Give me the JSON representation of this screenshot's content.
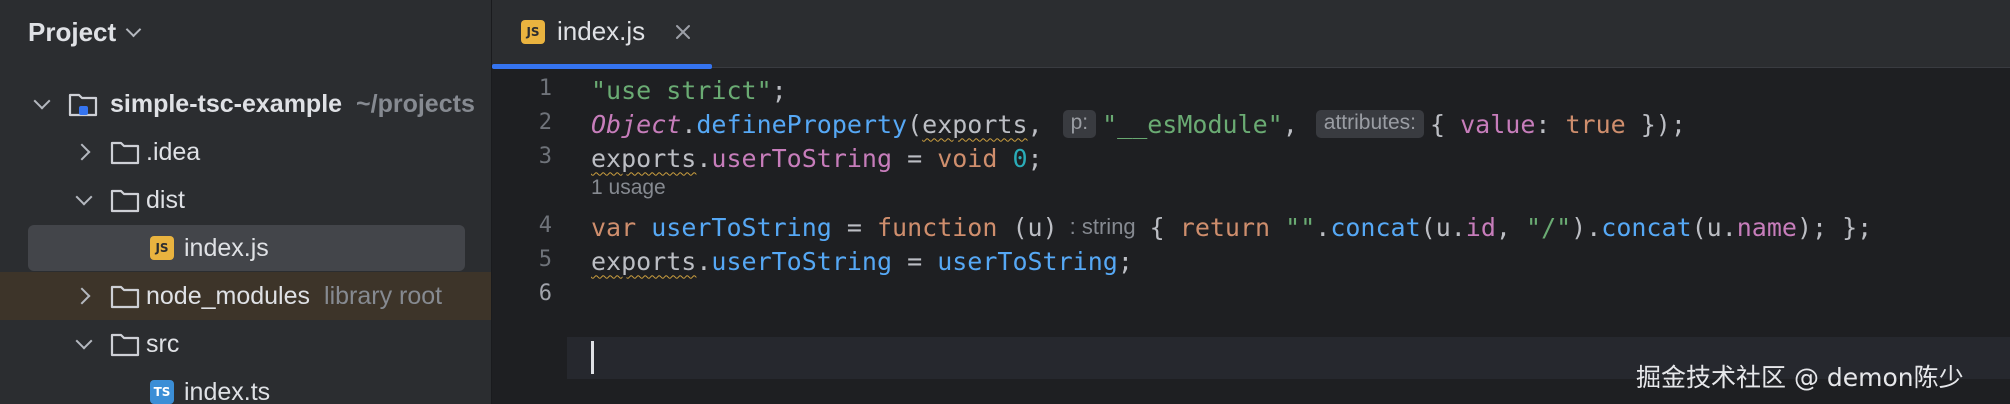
{
  "project": {
    "title": "Project",
    "tree": [
      {
        "label": "simple-tsc-example",
        "hint": "~/projects",
        "type": "root-folder",
        "expanded": true
      },
      {
        "label": ".idea",
        "type": "folder",
        "expanded": false
      },
      {
        "label": "dist",
        "type": "folder",
        "expanded": true
      },
      {
        "label": "index.js",
        "type": "js-file",
        "selected": true
      },
      {
        "label": "node_modules",
        "hint": "library root",
        "type": "folder",
        "expanded": false
      },
      {
        "label": "src",
        "type": "folder",
        "expanded": true
      },
      {
        "label": "index.ts",
        "type": "ts-file"
      }
    ]
  },
  "editor": {
    "tab": {
      "label": "index.js",
      "icon": "JS",
      "close": "✕"
    },
    "line_numbers": [
      "1",
      "2",
      "3",
      "4",
      "5",
      "6"
    ],
    "current_line": "6",
    "usage_hint": "1 usage",
    "lines": {
      "l1": {
        "str": "\"use strict\"",
        "semi": ";"
      },
      "l2": {
        "glob": "Object",
        "dot": ".",
        "fn": "defineProperty",
        "open": "(",
        "arg1": "exports",
        "comma1": ",",
        "inlay1": "p:",
        "str": "\"__esModule\"",
        "comma2": ",",
        "inlay2": "attributes:",
        "brace_open": "{ ",
        "prop": "value",
        "colon": ": ",
        "kw": "true",
        "tail": " });"
      },
      "l3": {
        "obj": "exports",
        "dot": ".",
        "prop": "userToString",
        "eq": " = ",
        "kw": "void",
        "sp": " ",
        "num": "0",
        "semi": ";"
      },
      "l4": {
        "kw_var": "var",
        "sp1": " ",
        "name": "userToString",
        "eq": " = ",
        "kw_fn": "function",
        "params": " (u)",
        "type_hint": ": string",
        "brace": "{ ",
        "kw_ret": "return",
        "sp2": " ",
        "str_empty": "\"\"",
        "dot1": ".",
        "fn1": "concat",
        "p1": "(u.",
        "prop_id": "id",
        "comma": ", ",
        "str_slash": "\"/\"",
        "close1": ").",
        "fn2": "concat",
        "p2": "(u.",
        "prop_name": "name",
        "tail": "); };"
      },
      "l5": {
        "obj": "exports",
        "dot": ".",
        "prop": "userToString",
        "eq": " = ",
        "ref": "userToString",
        "semi": ";"
      }
    }
  },
  "watermark": "掘金技术社区 @ demon陈少",
  "colors": {
    "panel_bg": "#2b2d30",
    "editor_bg": "#1e1f22",
    "selection": "#43454a",
    "library_row": "#3d3429",
    "accent": "#3574f0",
    "string": "#6aab73",
    "keyword": "#cf8e6d",
    "function": "#56a8f5",
    "number": "#2aacb8",
    "property": "#c77dbb"
  }
}
